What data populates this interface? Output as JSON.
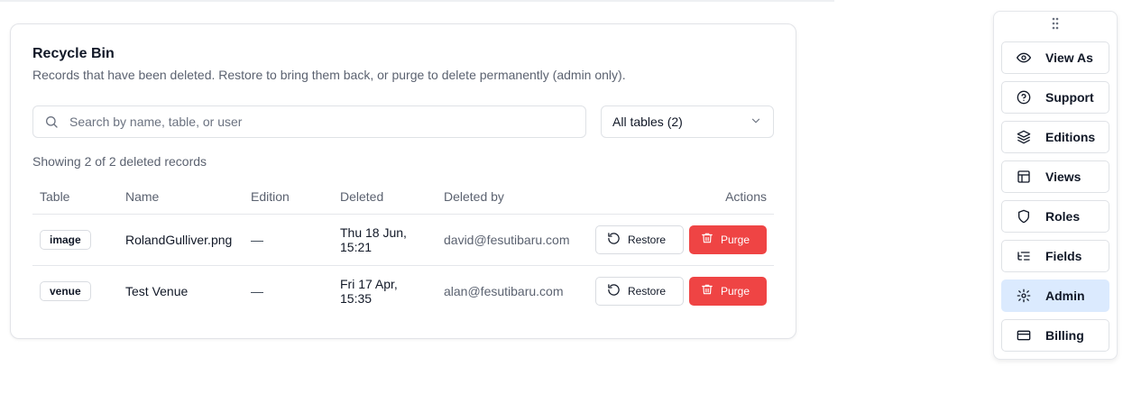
{
  "recycle_bin": {
    "title": "Recycle Bin",
    "description": "Records that have been deleted. Restore to bring them back, or purge to delete permanently (admin only).",
    "search": {
      "placeholder": "Search by name, table, or user",
      "value": ""
    },
    "table_filter": {
      "selected": "All tables (2)"
    },
    "showing_text": "Showing 2 of 2 deleted records",
    "columns": [
      "Table",
      "Name",
      "Edition",
      "Deleted",
      "Deleted by",
      "Actions"
    ],
    "rows": [
      {
        "table": "image",
        "name": "RolandGulliver.png",
        "edition": "—",
        "deleted_line1": "Thu 18 Jun,",
        "deleted_line2": "15:21",
        "deleted_by": "david@fesutibaru.com",
        "restore_label": "Restore",
        "purge_label": "Purge"
      },
      {
        "table": "venue",
        "name": "Test Venue",
        "edition": "—",
        "deleted_line1": "Fri 17 Apr,",
        "deleted_line2": "15:35",
        "deleted_by": "alan@fesutibaru.com",
        "restore_label": "Restore",
        "purge_label": "Purge"
      }
    ]
  },
  "side_panel": {
    "items": [
      {
        "label": "View As",
        "icon": "eye-icon"
      },
      {
        "label": "Support",
        "icon": "help-circle-icon"
      },
      {
        "label": "Editions",
        "icon": "layers-icon"
      },
      {
        "label": "Views",
        "icon": "layout-icon"
      },
      {
        "label": "Roles",
        "icon": "shield-icon"
      },
      {
        "label": "Fields",
        "icon": "list-tree-icon"
      },
      {
        "label": "Admin",
        "icon": "gear-icon",
        "active": true
      },
      {
        "label": "Billing",
        "icon": "credit-card-icon"
      }
    ]
  },
  "colors": {
    "purge": "#ef4444",
    "active_item": "#dbeafe",
    "muted_text": "#5b6270"
  }
}
